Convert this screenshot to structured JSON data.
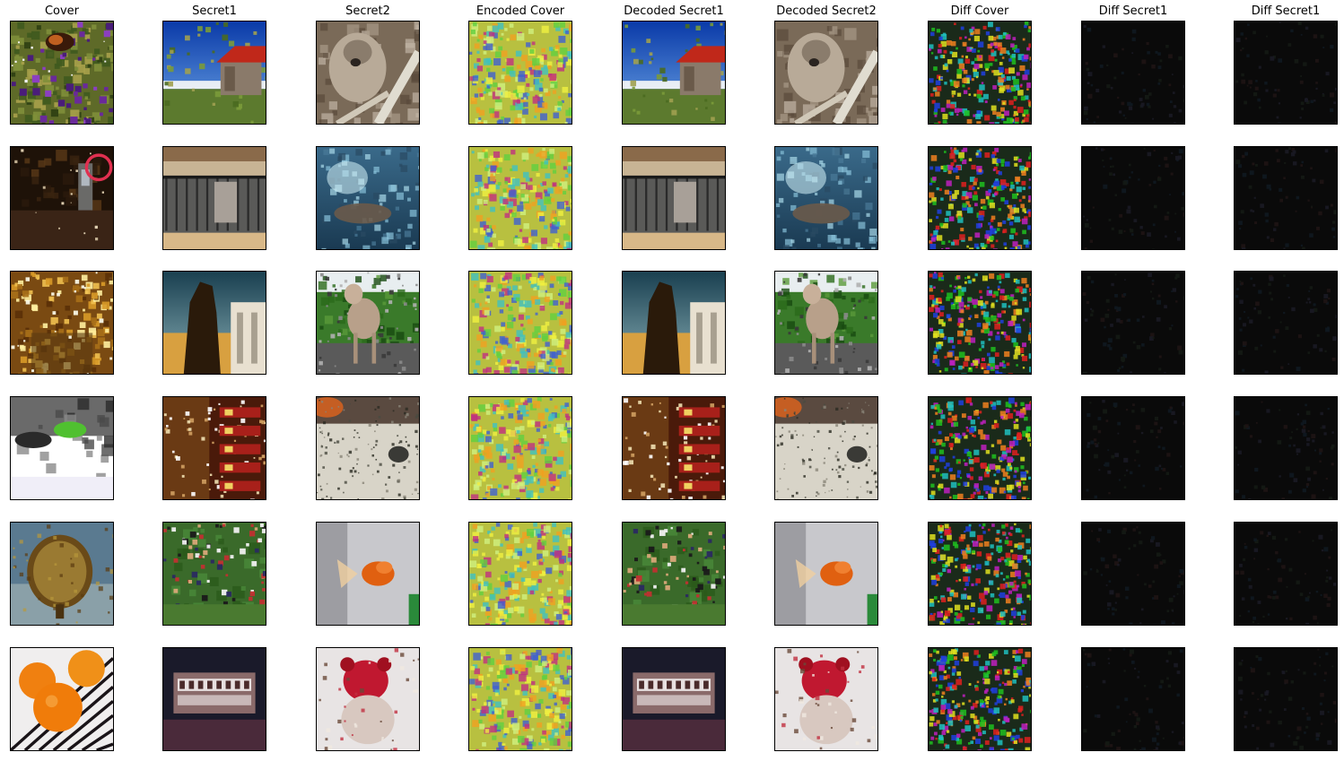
{
  "figure": {
    "columns": [
      {
        "key": "cover",
        "title": "Cover"
      },
      {
        "key": "secret1",
        "title": "Secret1"
      },
      {
        "key": "secret2",
        "title": "Secret2"
      },
      {
        "key": "encoded_cover",
        "title": "Encoded Cover"
      },
      {
        "key": "decoded_secret1",
        "title": "Decoded Secret1"
      },
      {
        "key": "decoded_secret2",
        "title": "Decoded Secret2"
      },
      {
        "key": "diff_cover",
        "title": "Diff Cover"
      },
      {
        "key": "diff_secret1",
        "title": "Diff Secret1"
      },
      {
        "key": "diff_secret2",
        "title": "Diff Secret1"
      }
    ],
    "rows": [
      {
        "cover": "butterfly-flowers",
        "secret1": "barn-blue-sky",
        "secret2": "koala",
        "encoded_cover": "encoded-noise",
        "decoded_secret1": "barn-blue-sky",
        "decoded_secret2": "koala",
        "diff_cover": "residual-rgb",
        "diff_secret1": "near-black",
        "diff_secret2": "near-black"
      },
      {
        "cover": "night-phone-booth",
        "secret1": "balcony",
        "secret2": "underwater",
        "encoded_cover": "encoded-noise",
        "decoded_secret1": "balcony",
        "decoded_secret2": "underwater",
        "diff_cover": "residual-rgb",
        "diff_secret1": "near-black",
        "diff_secret2": "near-black"
      },
      {
        "cover": "golden-interior",
        "secret1": "silhouette-building",
        "secret2": "poodle",
        "encoded_cover": "encoded-noise",
        "decoded_secret1": "silhouette-building",
        "decoded_secret2": "poodle",
        "diff_cover": "residual-rgb",
        "diff_secret1": "near-black",
        "diff_secret2": "near-black"
      },
      {
        "cover": "person-white-floor",
        "secret1": "lights-storefront",
        "secret2": "beach-snail",
        "encoded_cover": "encoded-noise",
        "decoded_secret1": "lights-storefront",
        "decoded_secret2": "beach-snail",
        "diff_cover": "residual-rgb",
        "diff_secret1": "near-black",
        "diff_secret2": "near-black"
      },
      {
        "cover": "brass-disc",
        "secret1": "crowd-on-grass",
        "secret2": "goldfish",
        "encoded_cover": "encoded-noise",
        "decoded_secret1": "crowd-on-grass",
        "decoded_secret2": "goldfish",
        "diff_cover": "residual-rgb",
        "diff_secret1": "near-black",
        "diff_secret2": "near-black"
      },
      {
        "cover": "oranges",
        "secret1": "sign-banner",
        "secret2": "red-teddy-bear",
        "encoded_cover": "encoded-noise",
        "decoded_secret1": "sign-banner",
        "decoded_secret2": "red-teddy-bear",
        "diff_cover": "residual-rgb",
        "diff_secret1": "near-black",
        "diff_secret2": "near-black"
      }
    ]
  }
}
